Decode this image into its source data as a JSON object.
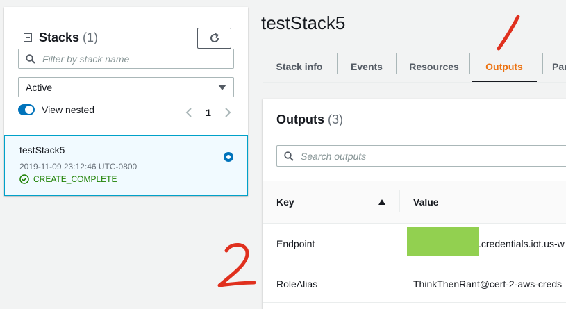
{
  "stacks_panel": {
    "title": "Stacks",
    "count": "(1)",
    "filter_placeholder": "Filter by stack name",
    "status_filter": "Active",
    "view_nested_label": "View nested",
    "page": "1",
    "items": [
      {
        "name": "testStack5",
        "timestamp": "2019-11-09 23:12:46 UTC-0800",
        "status": "CREATE_COMPLETE"
      }
    ]
  },
  "main": {
    "title": "testStack5",
    "tabs": [
      {
        "label": "Stack info"
      },
      {
        "label": "Events"
      },
      {
        "label": "Resources"
      },
      {
        "label": "Outputs"
      },
      {
        "label": "Par"
      }
    ],
    "active_tab": "Outputs"
  },
  "outputs": {
    "title": "Outputs",
    "count": "(3)",
    "search_placeholder": "Search outputs",
    "columns": {
      "key": "Key",
      "value": "Value"
    },
    "rows": [
      {
        "key": "Endpoint",
        "value": ".credentials.iot.us-w"
      },
      {
        "key": "RoleAlias",
        "value": "ThinkThenRant@cert-2-aws-creds"
      }
    ]
  },
  "annotations": {
    "mark_1": "1",
    "mark_2": "2"
  },
  "colors": {
    "accent": "#0073bb",
    "active_tab": "#ec7211",
    "success": "#1d8102",
    "redaction": "#92d050",
    "annotation": "#e0301e"
  },
  "icons": {
    "collapse": "collapse-icon",
    "refresh": "refresh-icon",
    "search": "search-icon",
    "chevron_left": "chevron-left-icon",
    "chevron_right": "chevron-right-icon",
    "status_ok": "check-circle-icon",
    "sort": "sort-ascending-icon"
  }
}
